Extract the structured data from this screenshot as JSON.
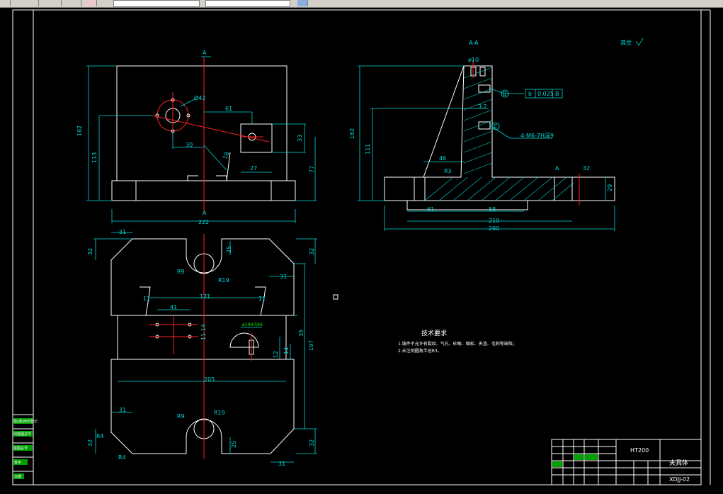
{
  "toolbar": {
    "field1": "",
    "field2": ""
  },
  "drawing": {
    "front_view": {
      "section_marks": [
        "A",
        "A"
      ],
      "dims": [
        "162",
        "113",
        "222",
        "77",
        "33",
        "27",
        "61",
        "30",
        "Ø42",
        "18"
      ]
    },
    "section_view": {
      "title": "A-A",
      "roughness_note": "其余",
      "dims": [
        "162",
        "111",
        "260",
        "210",
        "88",
        "61",
        "46",
        "R3",
        "29",
        "32",
        "3.2",
        "ø10"
      ],
      "tolerance_frame": [
        "b",
        "0.025",
        "B"
      ],
      "datum_b": "B",
      "datum_c": "C",
      "thread_note": "4-M6-7H深9",
      "mark_a": "A"
    },
    "top_view": {
      "dims": [
        "31",
        "32",
        "25",
        "32",
        "R9",
        "R19",
        "31",
        "131",
        "11",
        "11",
        "41",
        "11.14",
        "35",
        "197",
        "12",
        "14",
        "205",
        "31",
        "R4",
        "32",
        "R4",
        "R9",
        "R19",
        "25",
        "32",
        "31"
      ],
      "tol_note": "ø10H7/k6"
    },
    "tech_req": {
      "title": "技术要求",
      "line1": "1.铸件不允许有裂纹、气孔、砂眼、缩松、夹渣、毛刺等缺陷；",
      "line2": "2.未注明圆角半径R3。"
    },
    "title_block": {
      "material": "HT200",
      "part_name": "夹具体",
      "drawing_no": "XDJJ-02"
    },
    "left_block_labels": [
      "借(通)用件登记",
      "旧底图总号",
      "底图总号",
      "签字",
      "日期"
    ]
  },
  "colors": {
    "background": "#000000",
    "outline": "#ffffff",
    "dimension": "#00d8d8",
    "centerline": "#ff2020",
    "annotation": "#00ff00"
  }
}
